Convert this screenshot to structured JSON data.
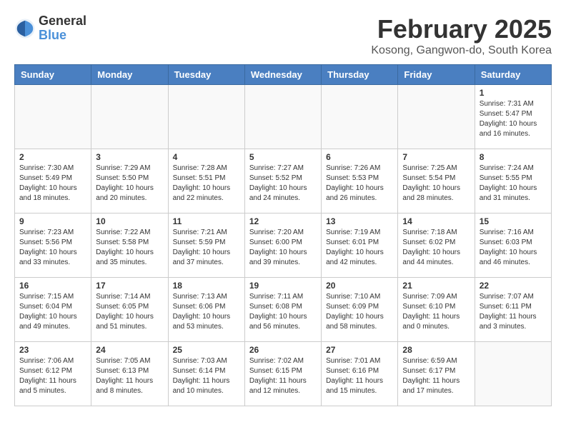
{
  "header": {
    "logo_general": "General",
    "logo_blue": "Blue",
    "title": "February 2025",
    "subtitle": "Kosong, Gangwon-do, South Korea"
  },
  "weekdays": [
    "Sunday",
    "Monday",
    "Tuesday",
    "Wednesday",
    "Thursday",
    "Friday",
    "Saturday"
  ],
  "weeks": [
    [
      {
        "day": "",
        "info": ""
      },
      {
        "day": "",
        "info": ""
      },
      {
        "day": "",
        "info": ""
      },
      {
        "day": "",
        "info": ""
      },
      {
        "day": "",
        "info": ""
      },
      {
        "day": "",
        "info": ""
      },
      {
        "day": "1",
        "info": "Sunrise: 7:31 AM\nSunset: 5:47 PM\nDaylight: 10 hours and 16 minutes."
      }
    ],
    [
      {
        "day": "2",
        "info": "Sunrise: 7:30 AM\nSunset: 5:49 PM\nDaylight: 10 hours and 18 minutes."
      },
      {
        "day": "3",
        "info": "Sunrise: 7:29 AM\nSunset: 5:50 PM\nDaylight: 10 hours and 20 minutes."
      },
      {
        "day": "4",
        "info": "Sunrise: 7:28 AM\nSunset: 5:51 PM\nDaylight: 10 hours and 22 minutes."
      },
      {
        "day": "5",
        "info": "Sunrise: 7:27 AM\nSunset: 5:52 PM\nDaylight: 10 hours and 24 minutes."
      },
      {
        "day": "6",
        "info": "Sunrise: 7:26 AM\nSunset: 5:53 PM\nDaylight: 10 hours and 26 minutes."
      },
      {
        "day": "7",
        "info": "Sunrise: 7:25 AM\nSunset: 5:54 PM\nDaylight: 10 hours and 28 minutes."
      },
      {
        "day": "8",
        "info": "Sunrise: 7:24 AM\nSunset: 5:55 PM\nDaylight: 10 hours and 31 minutes."
      }
    ],
    [
      {
        "day": "9",
        "info": "Sunrise: 7:23 AM\nSunset: 5:56 PM\nDaylight: 10 hours and 33 minutes."
      },
      {
        "day": "10",
        "info": "Sunrise: 7:22 AM\nSunset: 5:58 PM\nDaylight: 10 hours and 35 minutes."
      },
      {
        "day": "11",
        "info": "Sunrise: 7:21 AM\nSunset: 5:59 PM\nDaylight: 10 hours and 37 minutes."
      },
      {
        "day": "12",
        "info": "Sunrise: 7:20 AM\nSunset: 6:00 PM\nDaylight: 10 hours and 39 minutes."
      },
      {
        "day": "13",
        "info": "Sunrise: 7:19 AM\nSunset: 6:01 PM\nDaylight: 10 hours and 42 minutes."
      },
      {
        "day": "14",
        "info": "Sunrise: 7:18 AM\nSunset: 6:02 PM\nDaylight: 10 hours and 44 minutes."
      },
      {
        "day": "15",
        "info": "Sunrise: 7:16 AM\nSunset: 6:03 PM\nDaylight: 10 hours and 46 minutes."
      }
    ],
    [
      {
        "day": "16",
        "info": "Sunrise: 7:15 AM\nSunset: 6:04 PM\nDaylight: 10 hours and 49 minutes."
      },
      {
        "day": "17",
        "info": "Sunrise: 7:14 AM\nSunset: 6:05 PM\nDaylight: 10 hours and 51 minutes."
      },
      {
        "day": "18",
        "info": "Sunrise: 7:13 AM\nSunset: 6:06 PM\nDaylight: 10 hours and 53 minutes."
      },
      {
        "day": "19",
        "info": "Sunrise: 7:11 AM\nSunset: 6:08 PM\nDaylight: 10 hours and 56 minutes."
      },
      {
        "day": "20",
        "info": "Sunrise: 7:10 AM\nSunset: 6:09 PM\nDaylight: 10 hours and 58 minutes."
      },
      {
        "day": "21",
        "info": "Sunrise: 7:09 AM\nSunset: 6:10 PM\nDaylight: 11 hours and 0 minutes."
      },
      {
        "day": "22",
        "info": "Sunrise: 7:07 AM\nSunset: 6:11 PM\nDaylight: 11 hours and 3 minutes."
      }
    ],
    [
      {
        "day": "23",
        "info": "Sunrise: 7:06 AM\nSunset: 6:12 PM\nDaylight: 11 hours and 5 minutes."
      },
      {
        "day": "24",
        "info": "Sunrise: 7:05 AM\nSunset: 6:13 PM\nDaylight: 11 hours and 8 minutes."
      },
      {
        "day": "25",
        "info": "Sunrise: 7:03 AM\nSunset: 6:14 PM\nDaylight: 11 hours and 10 minutes."
      },
      {
        "day": "26",
        "info": "Sunrise: 7:02 AM\nSunset: 6:15 PM\nDaylight: 11 hours and 12 minutes."
      },
      {
        "day": "27",
        "info": "Sunrise: 7:01 AM\nSunset: 6:16 PM\nDaylight: 11 hours and 15 minutes."
      },
      {
        "day": "28",
        "info": "Sunrise: 6:59 AM\nSunset: 6:17 PM\nDaylight: 11 hours and 17 minutes."
      },
      {
        "day": "",
        "info": ""
      }
    ]
  ]
}
